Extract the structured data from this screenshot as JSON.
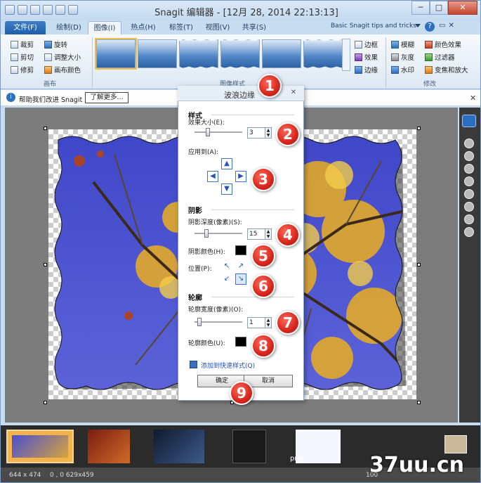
{
  "window": {
    "title": "Snagit 编辑器 - [12月 28, 2014 22:13:13]",
    "min": "─",
    "max": "□",
    "close": "✕"
  },
  "tabs": {
    "file": "文件(F)",
    "items": [
      "绘制(D)",
      "图像(I)",
      "热点(H)",
      "标签(T)",
      "视图(V)",
      "共享(S)"
    ],
    "active_index": 1
  },
  "ribbon_right": {
    "tips": "Basic Snagit tips and tricks",
    "help": "?",
    "restore": "▭",
    "close": "✕"
  },
  "ribbon": {
    "canvas_group": {
      "label": "画布",
      "buttons": [
        "裁剪",
        "剪切",
        "修剪",
        "旋转",
        "调整大小",
        "画布颜色"
      ]
    },
    "style_group": {
      "label": "图像样式",
      "buttons": [
        "边框",
        "效果",
        "边缘"
      ]
    },
    "modify_group": {
      "label": "修改",
      "buttons": [
        "模糊",
        "灰度",
        "水印",
        "颜色效果",
        "过滤器",
        "变焦和放大"
      ]
    }
  },
  "notice": {
    "text": "帮助我们改进 Snagit",
    "button": "了解更多...",
    "close": "✕",
    "info_icon": "i"
  },
  "dialog": {
    "title": "波浪边缘",
    "close": "✕",
    "style_section": "样式",
    "effect_size_label": "效果大小(E):",
    "effect_size_value": "3",
    "apply_to_label": "应用到(A):",
    "shadow_section": "阴影",
    "shadow_depth_label": "阴影深度(像素)(S):",
    "shadow_depth_value": "15",
    "shadow_color_label": "阴影颜色(H):",
    "position_label": "位置(P):",
    "outline_section": "轮廓",
    "outline_width_label": "轮廓宽度(像素)(O):",
    "outline_width_value": "1",
    "outline_color_label": "轮廓颜色(U):",
    "add_quick_style": "添加到快速样式(Q)",
    "ok": "确定",
    "cancel": "取消",
    "shadow_color": "#000000",
    "outline_color": "#000000",
    "effect_size_level": 0.25,
    "shadow_depth_level": 0.22,
    "outline_width_level": 0.05,
    "apply_arrows": [
      "▲",
      "◀",
      "▶",
      "▼"
    ],
    "position_arrows": [
      "↖",
      "↗",
      "↙",
      "↘"
    ],
    "position_selected": 3
  },
  "badges": [
    "1",
    "2",
    "3",
    "4",
    "5",
    "6",
    "7",
    "8",
    "9"
  ],
  "status": {
    "size": "644 x 474",
    "coords": "0 , 0  629x459",
    "zoom": "100"
  },
  "tray": {
    "thumb_label": "png"
  },
  "watermark": "37uu.cn",
  "colors": {
    "accent": "#2f6fc1",
    "badge": "#d7261b",
    "file_tab": "#1f5ea8"
  }
}
